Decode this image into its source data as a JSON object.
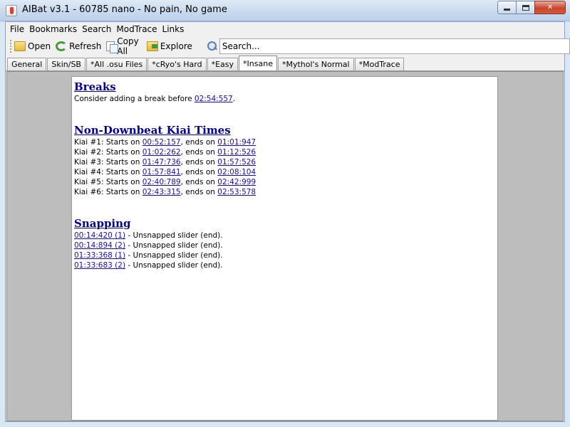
{
  "window": {
    "title": "AIBat v3.1 - 60785 nano - No pain, No game",
    "minimize_icon": "minimize-icon",
    "maximize_icon": "maximize-icon",
    "close_icon": "close-icon",
    "close_glyph": "✕"
  },
  "menu": {
    "items": [
      "File",
      "Bookmarks",
      "Search",
      "ModTrace",
      "Links"
    ]
  },
  "toolbar": {
    "open_label": "Open",
    "refresh_label": "Refresh",
    "copy_all_label": "Copy All",
    "explore_label": "Explore",
    "search_placeholder": "Search..."
  },
  "tabs": {
    "items": [
      "General",
      "Skin/SB",
      "*All .osu Files",
      "*cRyo's Hard",
      "*Easy",
      "*Insane",
      "*Mythol's Normal",
      "*ModTrace"
    ],
    "active_index": 5
  },
  "report": {
    "breaks": {
      "heading": "Breaks",
      "lines": [
        {
          "prefix": "Consider adding a break before ",
          "link": "02:54:557",
          "suffix": "."
        }
      ]
    },
    "kiai": {
      "heading": "Non-Downbeat Kiai Times",
      "lines": [
        {
          "prefix": "Kiai #1: Starts on ",
          "start": "00:52:157",
          "mid": ", ends on ",
          "end": "01:01:947"
        },
        {
          "prefix": "Kiai #2: Starts on ",
          "start": "01:02:262",
          "mid": ", ends on ",
          "end": "01:12:526"
        },
        {
          "prefix": "Kiai #3: Starts on ",
          "start": "01:47:736",
          "mid": ", ends on ",
          "end": "01:57:526"
        },
        {
          "prefix": "Kiai #4: Starts on ",
          "start": "01:57:841",
          "mid": ", ends on ",
          "end": "02:08:104"
        },
        {
          "prefix": "Kiai #5: Starts on ",
          "start": "02:40:789",
          "mid": ", ends on ",
          "end": "02:42:999"
        },
        {
          "prefix": "Kiai #6: Starts on ",
          "start": "02:43:315",
          "mid": ", ends on ",
          "end": "02:53:578"
        }
      ]
    },
    "snapping": {
      "heading": "Snapping",
      "lines": [
        {
          "link": "00:14:420 (1)",
          "suffix": " - Unsnapped slider (end)."
        },
        {
          "link": "00:14:894 (2)",
          "suffix": " - Unsnapped slider (end)."
        },
        {
          "link": "01:33:368 (1)",
          "suffix": " - Unsnapped slider (end)."
        },
        {
          "link": "01:33:683 (2)",
          "suffix": " - Unsnapped slider (end)."
        }
      ]
    }
  },
  "colors": {
    "link": "#1a0dab",
    "heading": "#00008b",
    "content_bg": "#bdbdbd"
  }
}
